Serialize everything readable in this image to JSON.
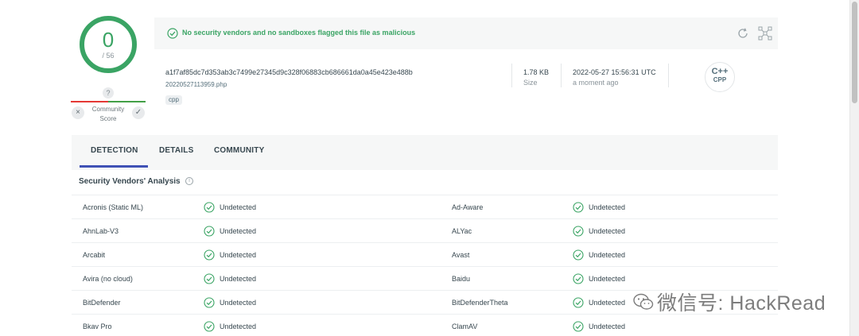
{
  "score": {
    "detections": "0",
    "total": "/ 56"
  },
  "community_score": {
    "question": "?",
    "label": "Community Score",
    "dislike": "×",
    "like": "✓"
  },
  "banner": {
    "text": "No security vendors and no sandboxes flagged this file as malicious"
  },
  "file": {
    "hash": "a1f7af85dc7d353ab3c7499e27345d9c328f06883cb686661da0a45e423e488b",
    "name": "20220527113959.php",
    "tag": "cpp",
    "size_value": "1.78 KB",
    "size_label": "Size",
    "date_value": "2022-05-27 15:56:31 UTC",
    "date_ago": "a moment ago",
    "type_badge_top": "C++",
    "type_badge_bottom": "CPP"
  },
  "tabs": [
    "DETECTION",
    "DETAILS",
    "COMMUNITY"
  ],
  "section": {
    "title": "Security Vendors' Analysis",
    "info": "i"
  },
  "vendors": [
    {
      "left": "Acronis (Static ML)",
      "left_status": "Undetected",
      "right": "Ad-Aware",
      "right_status": "Undetected"
    },
    {
      "left": "AhnLab-V3",
      "left_status": "Undetected",
      "right": "ALYac",
      "right_status": "Undetected"
    },
    {
      "left": "Arcabit",
      "left_status": "Undetected",
      "right": "Avast",
      "right_status": "Undetected"
    },
    {
      "left": "Avira (no cloud)",
      "left_status": "Undetected",
      "right": "Baidu",
      "right_status": "Undetected"
    },
    {
      "left": "BitDefender",
      "left_status": "Undetected",
      "right": "BitDefenderTheta",
      "right_status": "Undetected"
    },
    {
      "left": "Bkav Pro",
      "left_status": "Undetected",
      "right": "ClamAV",
      "right_status": "Undetected"
    }
  ],
  "watermark": {
    "text": "微信号: HackRead"
  },
  "colors": {
    "green": "#3aa464",
    "accent": "#3f51b5",
    "text": "#37474f"
  }
}
